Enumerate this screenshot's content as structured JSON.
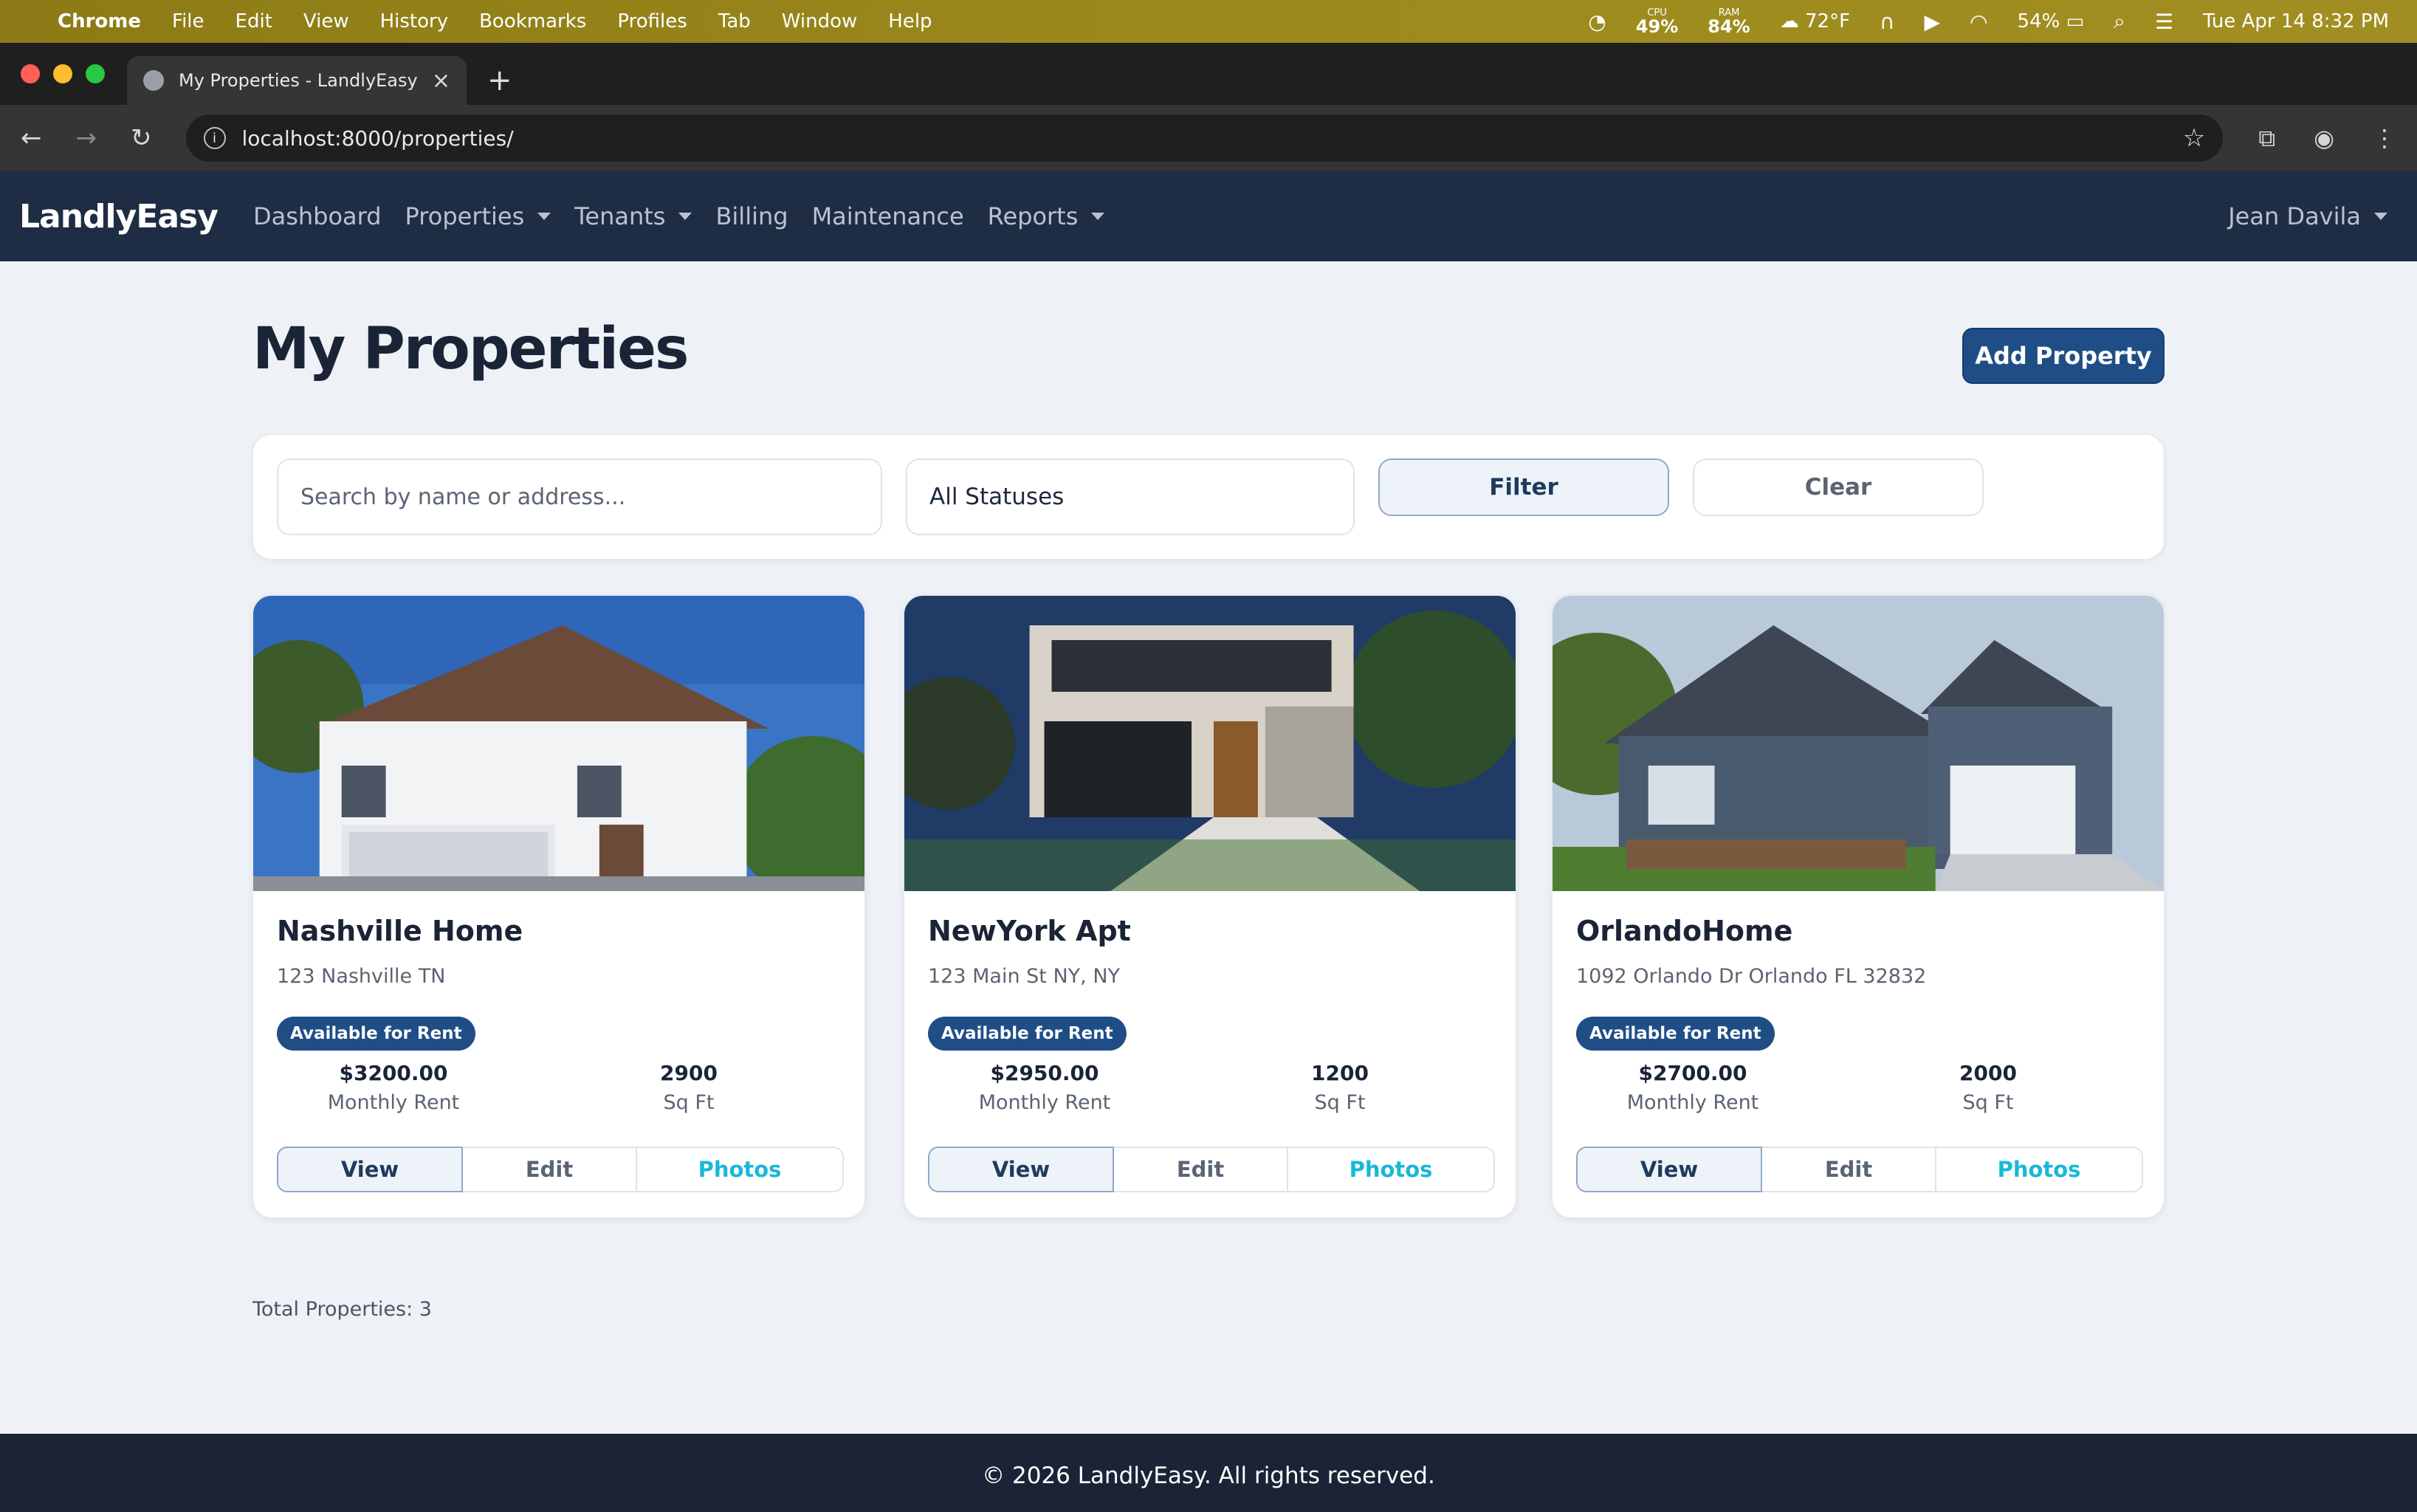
{
  "mac_menu": {
    "app": "Chrome",
    "items": [
      "File",
      "Edit",
      "View",
      "History",
      "Bookmarks",
      "Profiles",
      "Tab",
      "Window",
      "Help"
    ],
    "cpu_label": "CPU",
    "cpu_value": "49%",
    "ram_label": "RAM",
    "ram_value": "84%",
    "weather": "72°F",
    "battery": "54%",
    "datetime": "Tue Apr 14  8:32 PM"
  },
  "browser": {
    "tab_title": "My Properties - LandlyEasy",
    "url": "localhost:8000/properties/"
  },
  "navbar": {
    "brand": "LandlyEasy",
    "links": [
      {
        "label": "Dashboard",
        "dropdown": false
      },
      {
        "label": "Properties",
        "dropdown": true
      },
      {
        "label": "Tenants",
        "dropdown": true
      },
      {
        "label": "Billing",
        "dropdown": false
      },
      {
        "label": "Maintenance",
        "dropdown": false
      },
      {
        "label": "Reports",
        "dropdown": true
      }
    ],
    "user": "Jean Davila"
  },
  "page": {
    "title": "My Properties",
    "add_button": "Add Property"
  },
  "filters": {
    "search_placeholder": "Search by name or address...",
    "status_selected": "All Statuses",
    "filter_label": "Filter",
    "clear_label": "Clear"
  },
  "properties": [
    {
      "name": "Nashville Home",
      "address": "123 Nashville TN",
      "status": "Available for Rent",
      "rent": "$3200.00",
      "rent_label": "Monthly Rent",
      "sqft": "2900",
      "sqft_label": "Sq Ft",
      "view": "View",
      "edit": "Edit",
      "photos": "Photos"
    },
    {
      "name": "NewYork Apt",
      "address": "123 Main St NY, NY",
      "status": "Available for Rent",
      "rent": "$2950.00",
      "rent_label": "Monthly Rent",
      "sqft": "1200",
      "sqft_label": "Sq Ft",
      "view": "View",
      "edit": "Edit",
      "photos": "Photos"
    },
    {
      "name": "OrlandoHome",
      "address": "1092 Orlando Dr Orlando FL 32832",
      "status": "Available for Rent",
      "rent": "$2700.00",
      "rent_label": "Monthly Rent",
      "sqft": "2000",
      "sqft_label": "Sq Ft",
      "view": "View",
      "edit": "Edit",
      "photos": "Photos"
    }
  ],
  "summary": {
    "total": "Total Properties: 3"
  },
  "footer": {
    "text": "© 2026 LandlyEasy. All rights reserved."
  },
  "colors": {
    "navbar": "#1f2d44",
    "primary": "#1f4e86",
    "photos_link": "#18b8d8",
    "footer": "#1a2436"
  }
}
